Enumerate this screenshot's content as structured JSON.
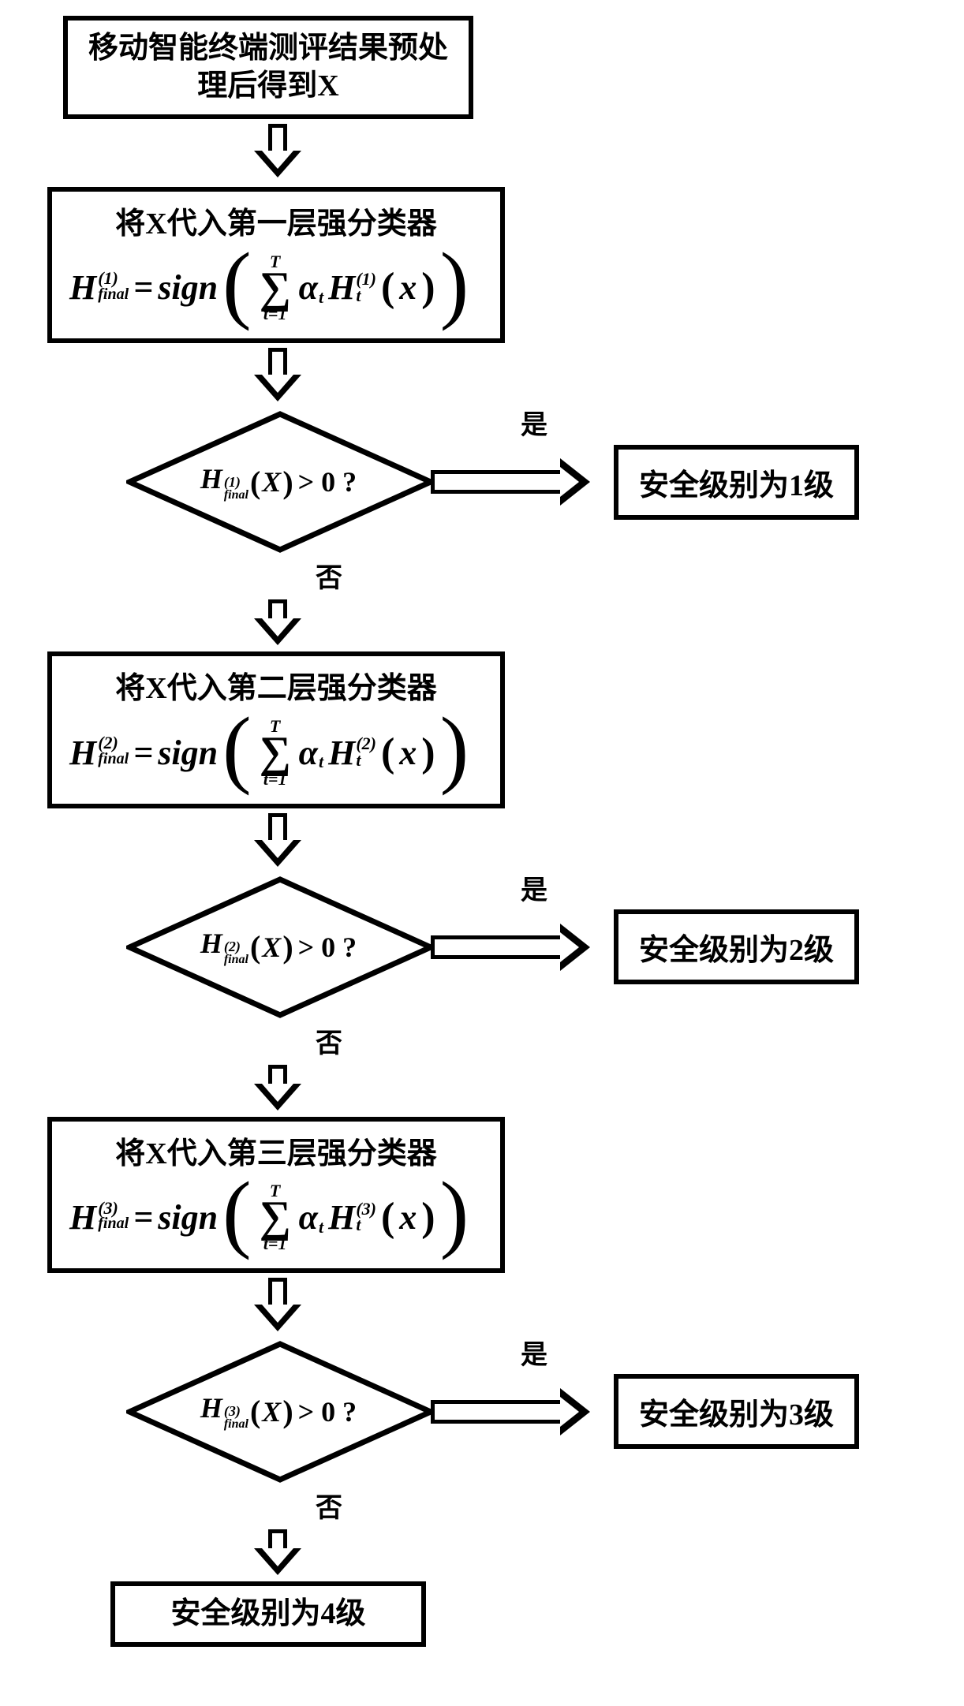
{
  "start": "移动智能终端测评结果预处理后得到X",
  "stages": [
    {
      "title": "将X代入第一层强分类器",
      "lhs_sup": "(1)",
      "rhs_sup": "(1)"
    },
    {
      "title": "将X代入第二层强分类器",
      "lhs_sup": "(2)",
      "rhs_sup": "(2)"
    },
    {
      "title": "将X代入第三层强分类器",
      "lhs_sup": "(3)",
      "rhs_sup": "(3)"
    }
  ],
  "formula": {
    "H": "H",
    "final_sub": "final",
    "eq": "=",
    "sign": "sign",
    "sigma_top": "T",
    "sigma_bot": "t=1",
    "alpha": "α",
    "t": "t",
    "x": "x"
  },
  "decision": {
    "X": "X",
    "gt0q": "> 0 ?",
    "yes": "是",
    "no": "否"
  },
  "results": {
    "r1": "安全级别为1级",
    "r2": "安全级别为2级",
    "r3": "安全级别为3级",
    "r4": "安全级别为4级"
  }
}
